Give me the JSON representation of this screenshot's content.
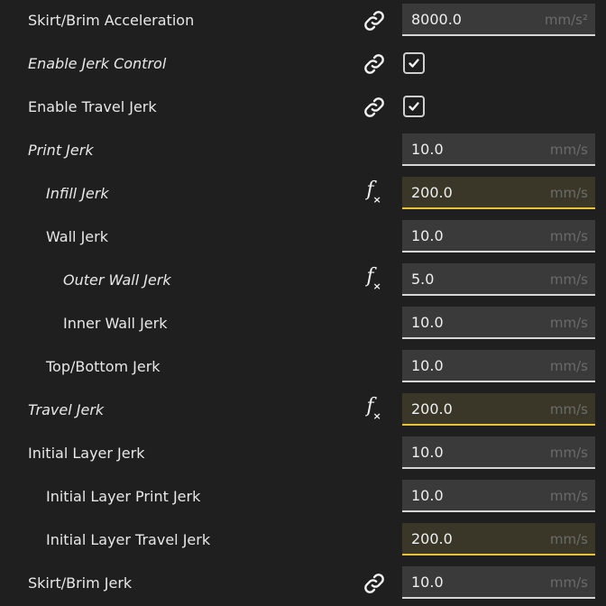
{
  "rows": [
    {
      "label": "Skirt/Brim Acceleration",
      "value": "8000.0",
      "unit": "mm/s²",
      "icon": "link-icon"
    },
    {
      "label": "Enable Jerk Control",
      "checked": true,
      "icon": "link-icon"
    },
    {
      "label": "Enable Travel Jerk",
      "checked": true,
      "icon": "link-icon"
    },
    {
      "label": "Print Jerk",
      "value": "10.0",
      "unit": "mm/s"
    },
    {
      "label": "Infill Jerk",
      "value": "200.0",
      "unit": "mm/s",
      "icon": "function-icon",
      "highlighted": true
    },
    {
      "label": "Wall Jerk",
      "value": "10.0",
      "unit": "mm/s"
    },
    {
      "label": "Outer Wall Jerk",
      "value": "5.0",
      "unit": "mm/s",
      "icon": "function-icon"
    },
    {
      "label": "Inner Wall Jerk",
      "value": "10.0",
      "unit": "mm/s"
    },
    {
      "label": "Top/Bottom Jerk",
      "value": "10.0",
      "unit": "mm/s"
    },
    {
      "label": "Travel Jerk",
      "value": "200.0",
      "unit": "mm/s",
      "icon": "function-icon",
      "highlighted": true
    },
    {
      "label": "Initial Layer Jerk",
      "value": "10.0",
      "unit": "mm/s"
    },
    {
      "label": "Initial Layer Print Jerk",
      "value": "10.0",
      "unit": "mm/s"
    },
    {
      "label": "Initial Layer Travel Jerk",
      "value": "200.0",
      "unit": "mm/s",
      "highlighted": true
    },
    {
      "label": "Skirt/Brim Jerk",
      "value": "10.0",
      "unit": "mm/s",
      "icon": "link-icon"
    }
  ],
  "colors": {
    "background": "#1f1f1f",
    "field": "#3a3a3a",
    "field_highlight": "#3b3728",
    "underline": "#d6d6d6",
    "underline_highlight": "#e9c23a",
    "unit_text": "#6b6b6b"
  }
}
